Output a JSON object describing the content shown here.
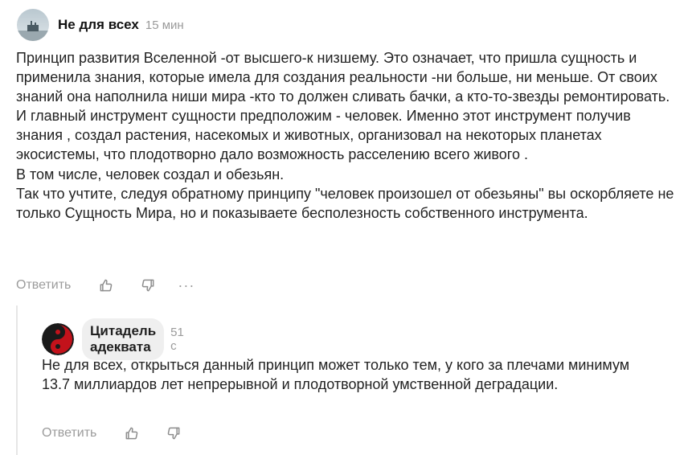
{
  "comments": [
    {
      "author": "Не для всех",
      "time": "15 мин",
      "text": "Принцип развития Вселенной -от высшего-к низшему. Это означает, что пришла сущность и применила знания, которые имела для создания реальности -ни больше, ни меньше. От своих знаний она наполнила ниши мира -кто то должен сливать бачки, а кто-то-звезды ремонтировать.\nИ главный инструмент сущности предположим - человек. Именно этот инструмент получив знания , создал растения, насекомых и животных, организовал на некоторых планетах экосистемы, что плодотворно дало возможность расселению всего живого .\nВ том числе, человек создал и обезьян.\nТак что учтите, следуя обратному принципу \"человек произошел от обезьяны\" вы оскорбляете не только Сущность Мира, но и показываете бесполезность собственного инструмента.",
      "actions": {
        "reply": "Ответить",
        "more": "···"
      },
      "avatar_icon": "landscape-avatar-icon"
    },
    {
      "author": "Цитадель адеквата",
      "time": "51 с",
      "text": "Не для всех, открыться данный принцип может только тем, у кого за плечами минимум 13.7 миллиардов лет непрерывной и плодотворной умственной деградации.",
      "actions": {
        "reply": "Ответить"
      },
      "avatar_icon": "yin-yang-avatar-icon"
    }
  ],
  "colors": {
    "muted": "#9b9b9b",
    "pill_bg": "#efefef",
    "thread_line": "#e6e6e6"
  }
}
